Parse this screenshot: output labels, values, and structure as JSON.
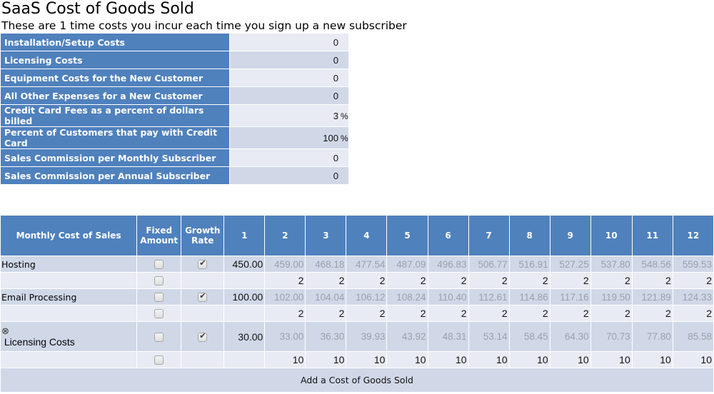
{
  "page": {
    "title": "SaaS Cost of Goods Sold",
    "subtitle": "These are 1 time costs you incur each time you sign up a new subscriber"
  },
  "one_time_costs": [
    {
      "label": "Installation/Setup Costs",
      "value": "0",
      "unit": ""
    },
    {
      "label": "Licensing Costs",
      "value": "0",
      "unit": ""
    },
    {
      "label": "Equipment Costs for the New Customer",
      "value": "0",
      "unit": ""
    },
    {
      "label": "All Other Expenses for a New Customer",
      "value": "0",
      "unit": ""
    },
    {
      "label": "Credit Card Fees as a percent of dollars billed",
      "value": "3",
      "unit": "%"
    },
    {
      "label": "Percent of Customers that pay with Credit Card",
      "value": "100",
      "unit": "%"
    },
    {
      "label": "Sales Commission per Monthly Subscriber",
      "value": "0",
      "unit": ""
    },
    {
      "label": "Sales Commission per Annual Subscriber",
      "value": "0",
      "unit": ""
    }
  ],
  "cogs_table": {
    "headers": {
      "name": "Monthly Cost of Sales",
      "fixed": [
        "Fixed",
        "Amount"
      ],
      "growth": [
        "Growth",
        "Rate"
      ],
      "months": [
        "1",
        "2",
        "3",
        "4",
        "5",
        "6",
        "7",
        "8",
        "9",
        "10",
        "11",
        "12"
      ]
    },
    "rows": [
      {
        "name": "Hosting",
        "removable": false,
        "fixed_checked": false,
        "growth_checked": true,
        "values": [
          "450.00",
          "459.00",
          "468.18",
          "477.54",
          "487.09",
          "496.83",
          "506.77",
          "516.91",
          "527.25",
          "537.80",
          "548.56",
          "559.53"
        ],
        "sub_fixed_checked": false,
        "rates": [
          "",
          "2",
          "2",
          "2",
          "2",
          "2",
          "2",
          "2",
          "2",
          "2",
          "2",
          "2"
        ]
      },
      {
        "name": "Email Processing",
        "removable": false,
        "fixed_checked": false,
        "growth_checked": true,
        "values": [
          "100.00",
          "102.00",
          "104.04",
          "106.12",
          "108.24",
          "110.40",
          "112.61",
          "114.86",
          "117.16",
          "119.50",
          "121.89",
          "124.33"
        ],
        "sub_fixed_checked": false,
        "rates": [
          "",
          "2",
          "2",
          "2",
          "2",
          "2",
          "2",
          "2",
          "2",
          "2",
          "2",
          "2"
        ]
      },
      {
        "name": "Licensing Costs",
        "removable": true,
        "remove_icon": "⊗",
        "fixed_checked": false,
        "growth_checked": true,
        "values": [
          "30.00",
          "33.00",
          "36.30",
          "39.93",
          "43.92",
          "48.31",
          "53.14",
          "58.45",
          "64.30",
          "70.73",
          "77.80",
          "85.58"
        ],
        "sub_fixed_checked": false,
        "rates": [
          "",
          "10",
          "10",
          "10",
          "10",
          "10",
          "10",
          "10",
          "10",
          "10",
          "10",
          "10"
        ]
      }
    ],
    "add_label": "Add a Cost of Goods Sold"
  }
}
